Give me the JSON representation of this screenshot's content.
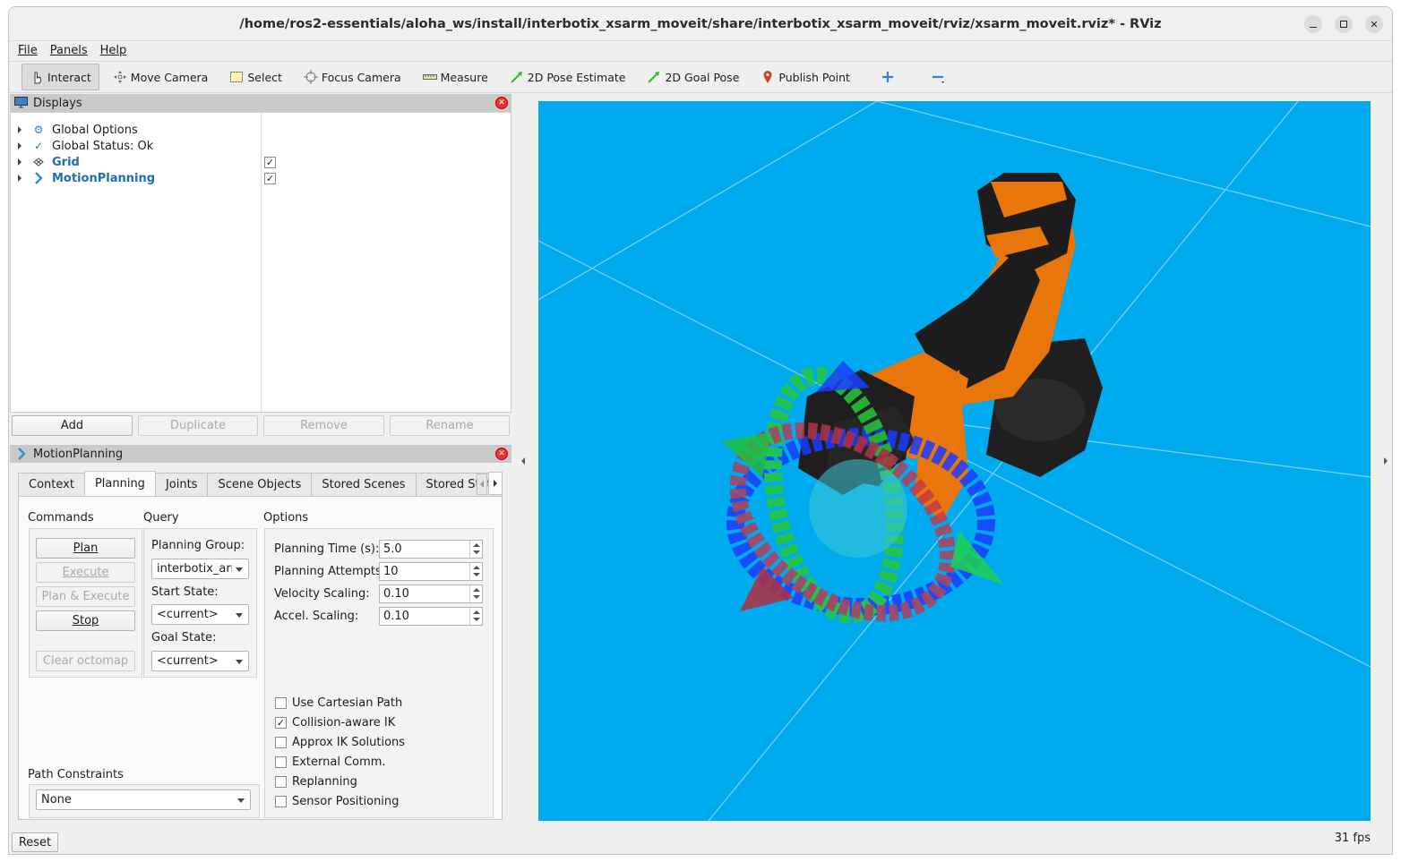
{
  "window": {
    "title": "/home/ros2-essentials/aloha_ws/install/interbotix_xsarm_moveit/share/interbotix_xsarm_moveit/rviz/xsarm_moveit.rviz* - RViz"
  },
  "menu": [
    "File",
    "Panels",
    "Help"
  ],
  "toolbar": {
    "tools": [
      {
        "label": "Interact",
        "icon": "hand-pointer-icon",
        "active": true
      },
      {
        "label": "Move Camera",
        "icon": "move-camera-icon"
      },
      {
        "label": "Select",
        "icon": "select-box-icon"
      },
      {
        "label": "Focus Camera",
        "icon": "focus-camera-icon"
      },
      {
        "label": "Measure",
        "icon": "ruler-icon"
      },
      {
        "label": "2D Pose Estimate",
        "icon": "green-arrow-icon"
      },
      {
        "label": "2D Goal Pose",
        "icon": "green-arrow-icon"
      },
      {
        "label": "Publish Point",
        "icon": "map-pin-icon"
      }
    ],
    "add_icon": "plus-icon",
    "remove_icon": "minus-icon"
  },
  "displays": {
    "title": "Displays",
    "items": [
      {
        "label": "Global Options",
        "icon": "gear-icon",
        "highlight": false,
        "checked": null
      },
      {
        "label": "Global Status: Ok",
        "icon": "checkmark-icon",
        "highlight": false,
        "checked": null
      },
      {
        "label": "Grid",
        "icon": "grid-icon",
        "highlight": true,
        "checked": true
      },
      {
        "label": "MotionPlanning",
        "icon": "motion-planning-icon",
        "highlight": true,
        "checked": true
      }
    ],
    "buttons": {
      "add": "Add",
      "duplicate": "Duplicate",
      "remove": "Remove",
      "rename": "Rename"
    }
  },
  "motion_planning": {
    "title": "MotionPlanning",
    "tabs": [
      "Context",
      "Planning",
      "Joints",
      "Scene Objects",
      "Stored Scenes",
      "Stored State"
    ],
    "active_tab": "Planning",
    "commands": {
      "heading": "Commands",
      "plan": "Plan",
      "execute": "Execute",
      "plan_execute": "Plan & Execute",
      "stop": "Stop",
      "clear_octomap": "Clear octomap"
    },
    "query": {
      "heading": "Query",
      "planning_group_label": "Planning Group:",
      "planning_group_value": "interbotix_arn",
      "start_state_label": "Start State:",
      "start_state_value": "<current>",
      "goal_state_label": "Goal State:",
      "goal_state_value": "<current>"
    },
    "options": {
      "heading": "Options",
      "planning_time_label": "Planning Time (s):",
      "planning_time_value": "5.0",
      "planning_attempts_label": "Planning Attempts:",
      "planning_attempts_value": "10",
      "velocity_scaling_label": "Velocity Scaling:",
      "velocity_scaling_value": "0.10",
      "accel_scaling_label": "Accel. Scaling:",
      "accel_scaling_value": "0.10",
      "checkboxes": [
        {
          "label": "Use Cartesian Path",
          "checked": false
        },
        {
          "label": "Collision-aware IK",
          "checked": true
        },
        {
          "label": "Approx IK Solutions",
          "checked": false
        },
        {
          "label": "External Comm.",
          "checked": false
        },
        {
          "label": "Replanning",
          "checked": false
        },
        {
          "label": "Sensor Positioning",
          "checked": false
        }
      ]
    },
    "path_constraints": {
      "heading": "Path Constraints",
      "value": "None"
    }
  },
  "footer": {
    "reset": "Reset",
    "fps": "31 fps"
  },
  "colors": {
    "viewport_bg": "#00aaee",
    "robot_orange": "#e8760a",
    "robot_black": "#1e1e1e",
    "link_blue": "#1c6fb6"
  }
}
